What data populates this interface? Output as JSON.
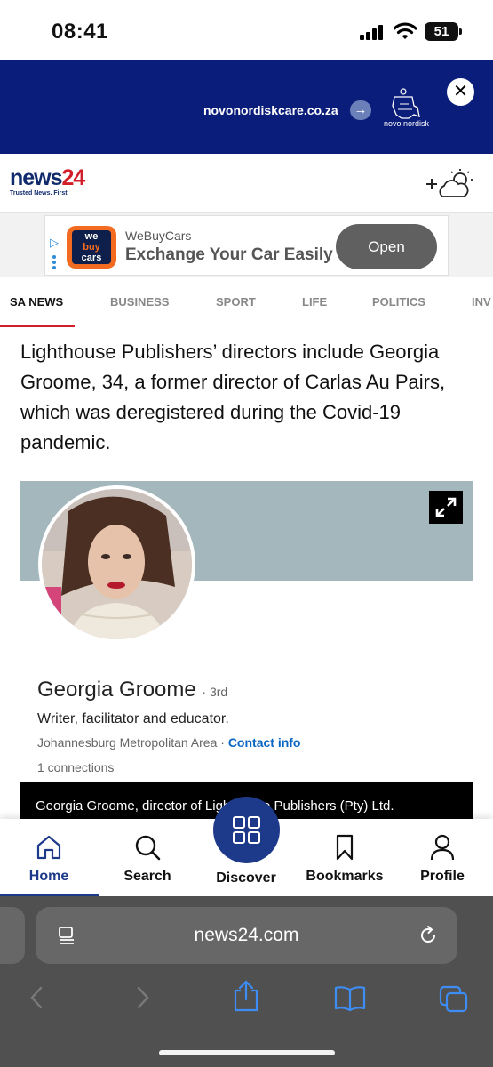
{
  "status_bar": {
    "time": "08:41",
    "battery": "51"
  },
  "ad_banner": {
    "url": "novonordiskcare.co.za",
    "brand": "novo nordisk",
    "close_label": "✕"
  },
  "header": {
    "logo_main": "news",
    "logo_num": "24",
    "logo_tagline": "Trusted News. First"
  },
  "sponsored": {
    "brand": "WeBuyCars",
    "headline": "Exchange Your Car Easily",
    "cta": "Open",
    "logo_lines": [
      "we",
      "buy",
      "cars"
    ]
  },
  "tabs": [
    "SA NEWS",
    "BUSINESS",
    "SPORT",
    "LIFE",
    "POLITICS",
    "INV"
  ],
  "article": {
    "paragraph": "Lighthouse Publishers’ directors include Georgia Groome, 34, a former director of Carlas Au Pairs, which was deregistered during the Covid-19 pandemic."
  },
  "embed": {
    "name": "Georgia Groome",
    "degree": "· 3rd",
    "headline": "Writer, facilitator and educator.",
    "location": "Johannesburg Metropolitan Area",
    "location_sep": " · ",
    "contact": "Contact info",
    "connections": "1 connections",
    "caption": "Georgia Groome, director of Lighthouse Publishers (Pty) Ltd."
  },
  "bottom_nav": {
    "items": [
      {
        "label": "Home",
        "icon": "home-icon",
        "active": true
      },
      {
        "label": "Search",
        "icon": "search-icon"
      },
      {
        "label": "Discover",
        "icon": "grid-icon"
      },
      {
        "label": "Bookmarks",
        "icon": "bookmark-icon"
      },
      {
        "label": "Profile",
        "icon": "profile-icon"
      }
    ]
  },
  "browser": {
    "url": "news24.com"
  },
  "colors": {
    "brand_blue": "#1d3a8a",
    "brand_red": "#d21d2a",
    "ad_navy": "#0b1d7a",
    "link_blue": "#0a66c2",
    "safari_blue": "#3d8df5"
  }
}
